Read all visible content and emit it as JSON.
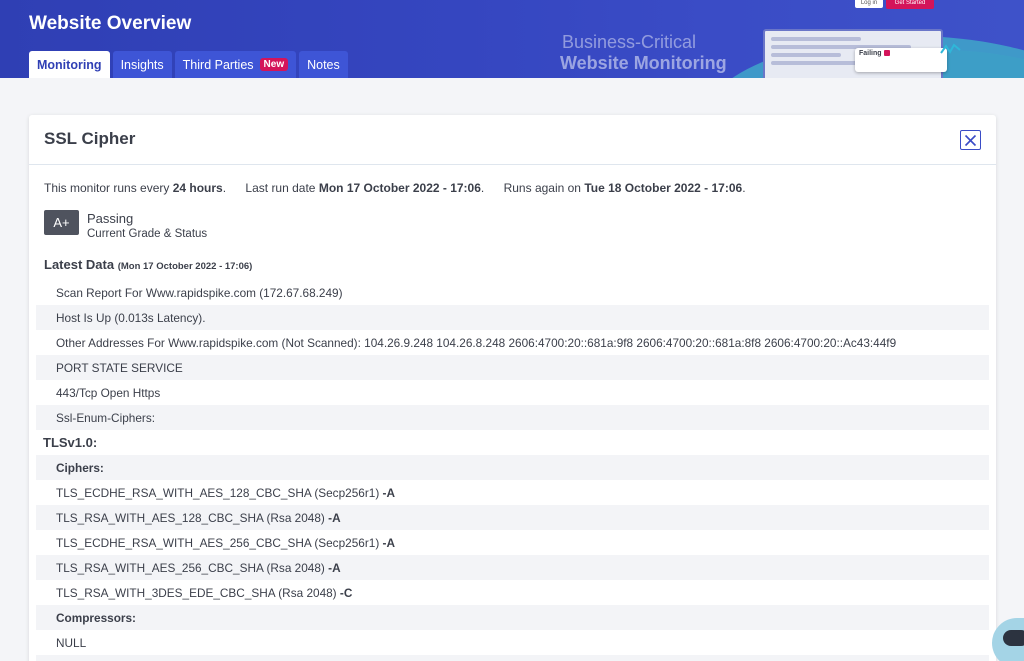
{
  "header": {
    "title": "Website Overview",
    "tabs": [
      {
        "label": "Monitoring",
        "active": true
      },
      {
        "label": "Insights"
      },
      {
        "label": "Third Parties",
        "badge": "New"
      },
      {
        "label": "Notes"
      }
    ],
    "promo": {
      "line1": "Business-Critical",
      "line2": "Website Monitoring",
      "login": "Log in",
      "get_started": "Get Started",
      "failing_label": "Failing"
    }
  },
  "modal": {
    "title": "SSL Cipher",
    "close_icon": "close-icon",
    "info": {
      "runs_prefix": "This monitor runs every",
      "runs_value": "24 hours",
      "last_run_prefix": "Last run date",
      "last_run_value": "Mon 17 October 2022 - 17:06",
      "runs_again_prefix": "Runs again on",
      "runs_again_value": "Tue 18 October 2022 - 17:06"
    },
    "grade": "A+",
    "status": "Passing",
    "status_sub": "Current Grade & Status",
    "latest_title": "Latest Data",
    "latest_date": "(Mon 17 October 2022 - 17:06)",
    "rows": [
      {
        "text": "Scan Report For Www.rapidspike.com (172.67.68.249)"
      },
      {
        "text": "Host Is Up (0.013s Latency)."
      },
      {
        "text": "Other Addresses For Www.rapidspike.com (Not Scanned): 104.26.9.248 104.26.8.248 2606:4700:20::681a:9f8 2606:4700:20::681a:8f8 2606:4700:20::Ac43:44f9"
      },
      {
        "text": "PORT STATE SERVICE"
      },
      {
        "text": "443/Tcp Open Https"
      },
      {
        "text": "Ssl-Enum-Ciphers:"
      },
      {
        "text": "TLSv1.0:",
        "kind": "section"
      },
      {
        "text": "Ciphers:",
        "kind": "subhead"
      },
      {
        "text": "TLS_ECDHE_RSA_WITH_AES_128_CBC_SHA (Secp256r1)",
        "grade": "A"
      },
      {
        "text": "TLS_RSA_WITH_AES_128_CBC_SHA (Rsa 2048)",
        "grade": "A"
      },
      {
        "text": "TLS_ECDHE_RSA_WITH_AES_256_CBC_SHA (Secp256r1)",
        "grade": "A"
      },
      {
        "text": "TLS_RSA_WITH_AES_256_CBC_SHA (Rsa 2048)",
        "grade": "A"
      },
      {
        "text": "TLS_RSA_WITH_3DES_EDE_CBC_SHA (Rsa 2048)",
        "grade": "C"
      },
      {
        "text": "Compressors:",
        "kind": "subhead"
      },
      {
        "text": "NULL"
      },
      {
        "text": ""
      }
    ]
  },
  "chat": {
    "icon": "chat-icon"
  },
  "colors": {
    "brand": "#3546c0",
    "accent": "#d4145a",
    "grade_box": "#4f535e"
  }
}
